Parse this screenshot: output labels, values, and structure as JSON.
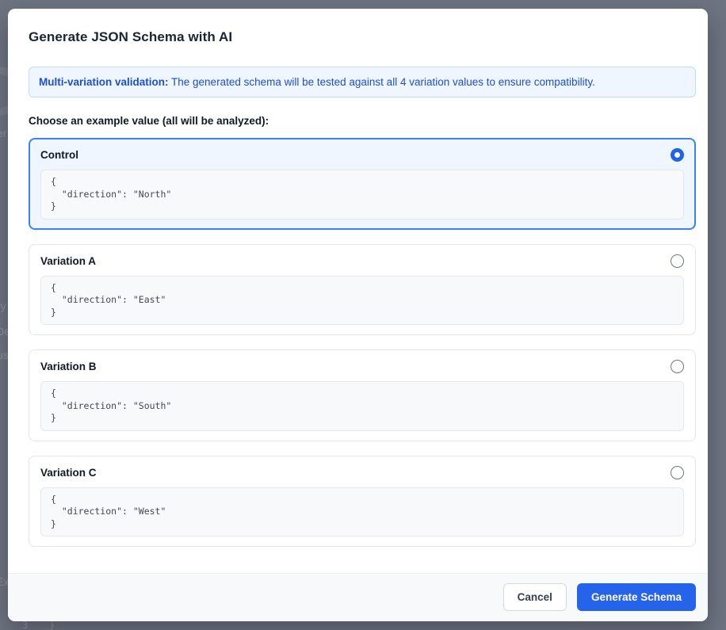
{
  "dialog": {
    "title": "Generate JSON Schema with AI",
    "banner": {
      "bold": "Multi-variation validation:",
      "text": " The generated schema will be tested against all 4 variation values to ensure compatibility."
    },
    "choose_label": "Choose an example value (all will be analyzed):",
    "options": [
      {
        "label": "Control",
        "code": "{\n  \"direction\": \"North\"\n}",
        "selected": true
      },
      {
        "label": "Variation A",
        "code": "{\n  \"direction\": \"East\"\n}",
        "selected": false
      },
      {
        "label": "Variation B",
        "code": "{\n  \"direction\": \"South\"\n}",
        "selected": false
      },
      {
        "label": "Variation C",
        "code": "{\n  \"direction\": \"West\"\n}",
        "selected": false
      }
    ],
    "footer": {
      "cancel_label": "Cancel",
      "submit_label": "Generate Schema"
    },
    "colors": {
      "accent": "#2563eb",
      "selected_border": "#3b82f6",
      "selected_bg": "#eff6ff",
      "banner_bg": "#eff6ff",
      "banner_border": "#bfdbfe",
      "banner_text": "#1d4ed8",
      "overlay": "#6d7380"
    }
  },
  "background": {
    "fragments": {
      "f1": "er",
      "f2": "ry",
      "f3": "De",
      "f4": "us",
      "f5": "Ex",
      "f6": "3",
      "f7": "}"
    }
  }
}
